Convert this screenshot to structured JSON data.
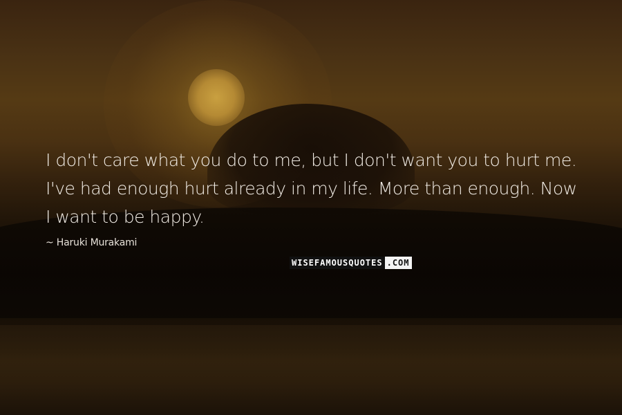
{
  "quote": {
    "text": "I don't care what you do to me, but I don't want you to hurt me. I've had enough hurt already in my life. More than enough. Now I want to be happy.",
    "author": "~ Haruki Murakami"
  },
  "watermark": {
    "main": "WISEFAMOUSQUOTES",
    "suffix": ".COM"
  },
  "colors": {
    "text": "#f2ede6",
    "sky": "#4a3214",
    "sun": "#c9a040"
  }
}
